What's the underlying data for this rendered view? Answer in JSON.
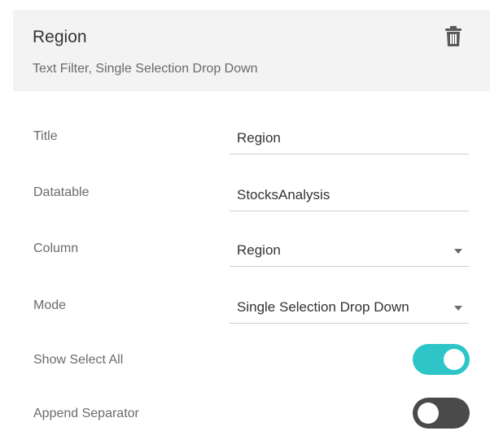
{
  "header": {
    "title": "Region",
    "subtitle": "Text Filter, Single Selection Drop Down",
    "delete_icon": "trash-icon"
  },
  "fields": {
    "title": {
      "label": "Title",
      "value": "Region"
    },
    "datatable": {
      "label": "Datatable",
      "value": "StocksAnalysis"
    },
    "column": {
      "label": "Column",
      "value": "Region",
      "icon": "chevron-down-icon"
    },
    "mode": {
      "label": "Mode",
      "value": "Single Selection Drop Down",
      "icon": "chevron-down-icon"
    }
  },
  "toggles": {
    "show_select_all": {
      "label": "Show Select All",
      "on": true
    },
    "append_separator": {
      "label": "Append Separator",
      "on": false
    }
  },
  "colors": {
    "toggle_on": "#2ec5c8",
    "toggle_off": "#4a4a4a",
    "header_bg": "#f3f3f3"
  }
}
